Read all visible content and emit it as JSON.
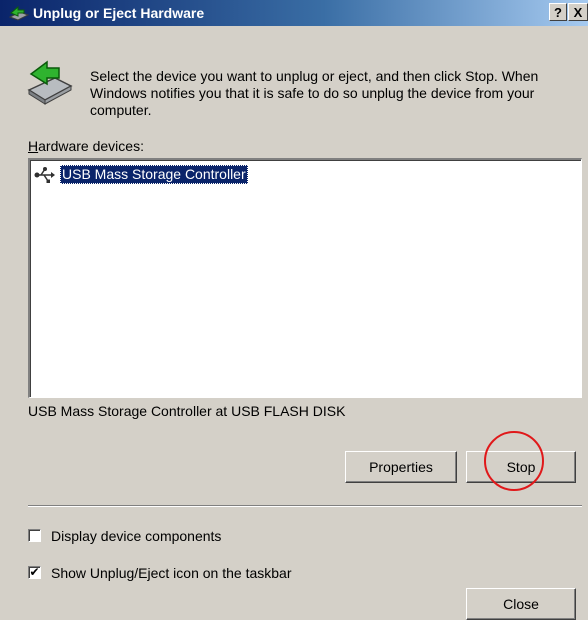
{
  "window": {
    "title": "Unplug or Eject Hardware",
    "help_button": "?",
    "close_button": "X"
  },
  "instructions": "Select the device you want to unplug or eject, and then click Stop. When Windows notifies you that it is safe to do so unplug the device from your computer.",
  "hardware_devices": {
    "label": "Hardware devices:",
    "items": [
      {
        "label": "USB Mass Storage Controller",
        "icon": "usb-icon",
        "selected": true
      }
    ]
  },
  "selected_device_description": "USB Mass Storage Controller at USB FLASH DISK",
  "buttons": {
    "properties": "Properties",
    "stop": "Stop",
    "close": "Close"
  },
  "options": {
    "display_components": {
      "label": "Display device components",
      "checked": false
    },
    "show_icon": {
      "label": "Show Unplug/Eject icon on the taskbar",
      "checked": true
    }
  },
  "annotation": {
    "color": "#e0181a"
  },
  "colors": {
    "title_start": "#0a246a",
    "title_end": "#a6caf0",
    "dialog_bg": "#d4d0c8",
    "selection": "#0a246a"
  }
}
